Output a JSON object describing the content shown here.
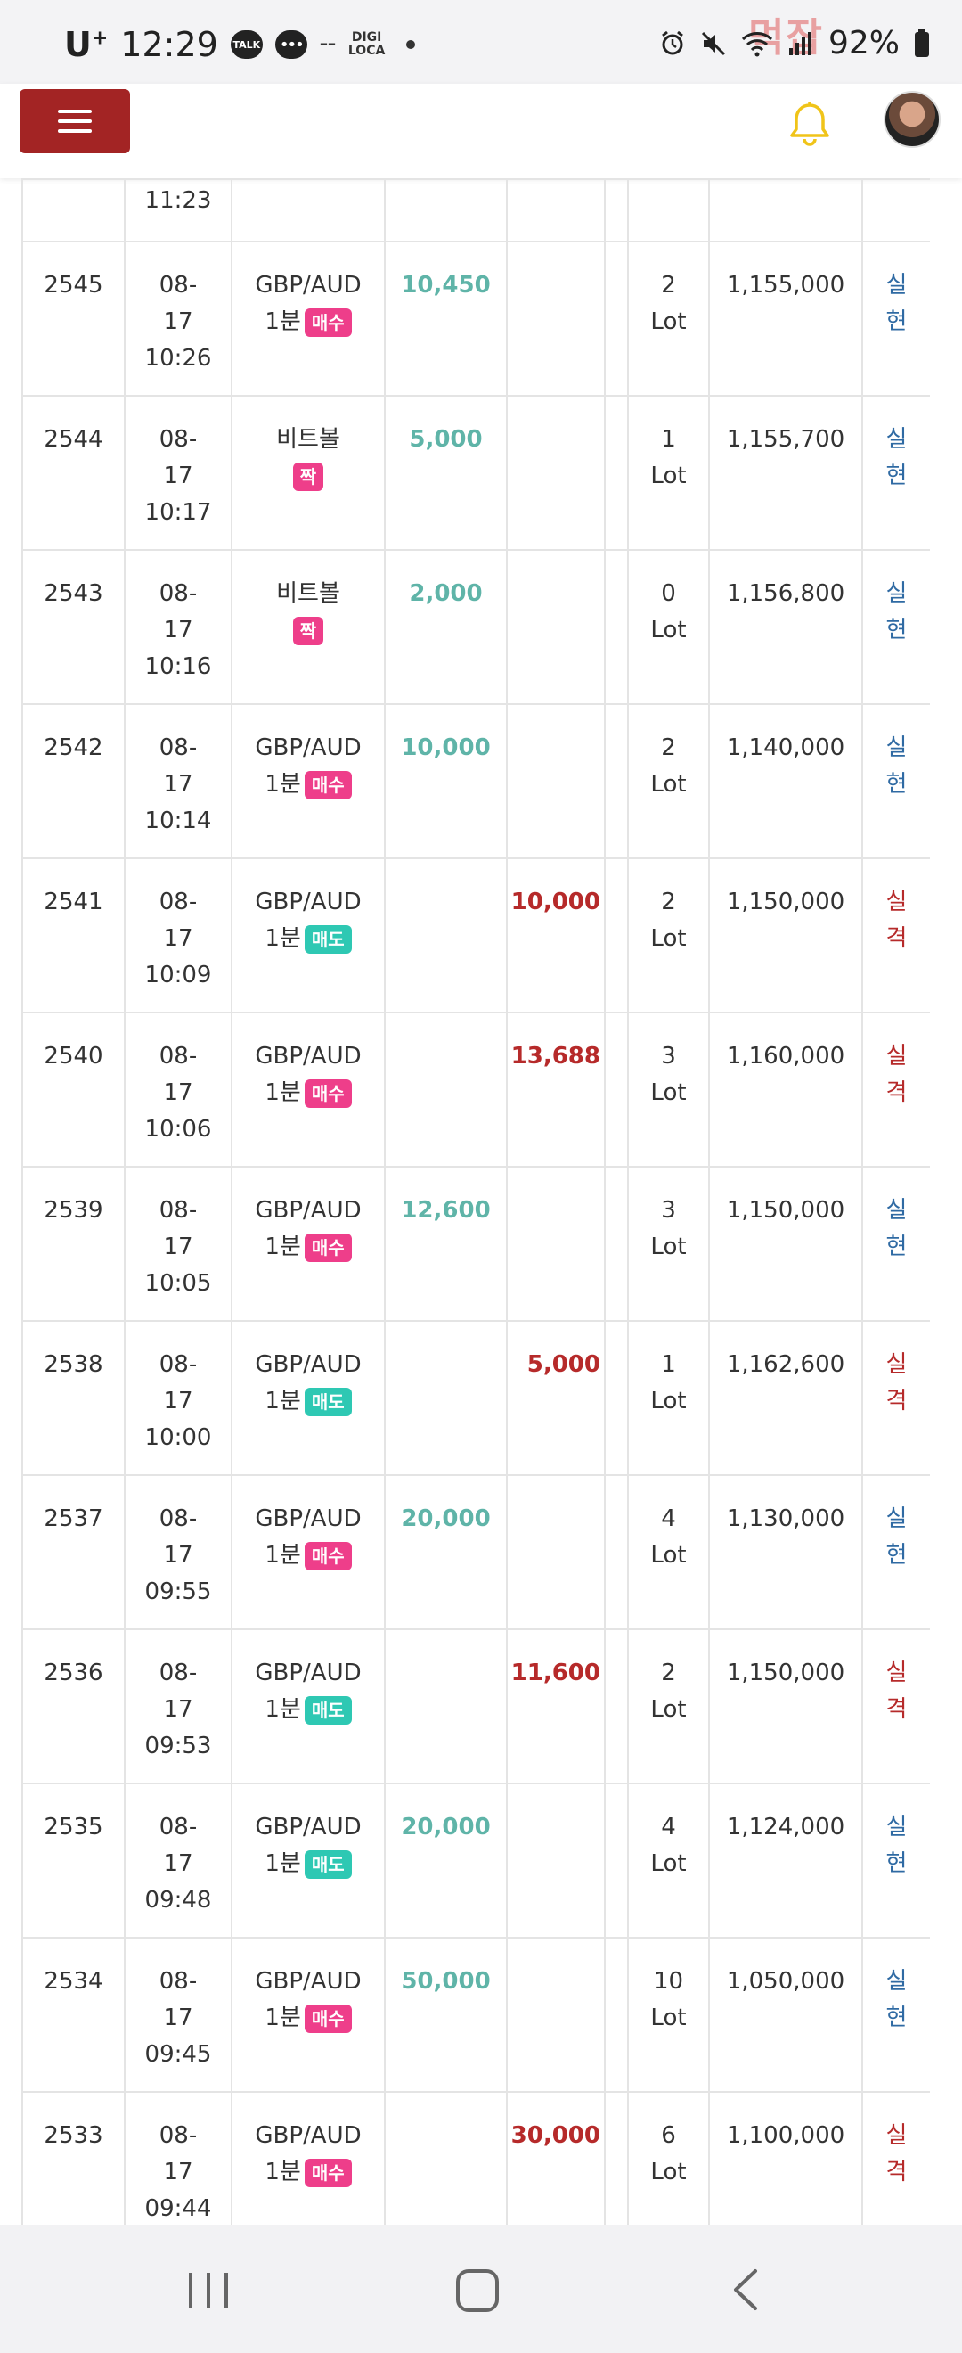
{
  "status": {
    "carrier": "U",
    "carrier_sup": "+",
    "time": "12:29",
    "talk": "TALK",
    "digi_top": "DIGI",
    "digi_bottom": "LOCA",
    "battery": "92%",
    "watermark": "먹잡"
  },
  "header": {
    "menu_icon": "hamburger-icon",
    "bell_icon": "bell-icon",
    "accent": "#a32424",
    "bell_color": "#f0c419"
  },
  "table": {
    "partial_time": "11:23",
    "rows": [
      {
        "no": "2545",
        "date": "08-",
        "day": "17",
        "time": "10:26",
        "item": "GBP/AUD",
        "period": "1분",
        "side": "매수",
        "side_type": "buy",
        "profit": "10,450",
        "loss": "",
        "lot": "2",
        "lot_unit": "Lot",
        "balance": "1,155,000",
        "res1": "실",
        "res2": "현",
        "res_type": "ok"
      },
      {
        "no": "2544",
        "date": "08-",
        "day": "17",
        "time": "10:17",
        "item": "비트볼",
        "period": "",
        "side": "짝",
        "side_type": "buy",
        "profit": "5,000",
        "loss": "",
        "lot": "1",
        "lot_unit": "Lot",
        "balance": "1,155,700",
        "res1": "실",
        "res2": "현",
        "res_type": "ok"
      },
      {
        "no": "2543",
        "date": "08-",
        "day": "17",
        "time": "10:16",
        "item": "비트볼",
        "period": "",
        "side": "짝",
        "side_type": "buy",
        "profit": "2,000",
        "loss": "",
        "lot": "0",
        "lot_unit": "Lot",
        "balance": "1,156,800",
        "res1": "실",
        "res2": "현",
        "res_type": "ok"
      },
      {
        "no": "2542",
        "date": "08-",
        "day": "17",
        "time": "10:14",
        "item": "GBP/AUD",
        "period": "1분",
        "side": "매수",
        "side_type": "buy",
        "profit": "10,000",
        "loss": "",
        "lot": "2",
        "lot_unit": "Lot",
        "balance": "1,140,000",
        "res1": "실",
        "res2": "현",
        "res_type": "ok"
      },
      {
        "no": "2541",
        "date": "08-",
        "day": "17",
        "time": "10:09",
        "item": "GBP/AUD",
        "period": "1분",
        "side": "매도",
        "side_type": "sell",
        "profit": "",
        "loss": "10,000",
        "lot": "2",
        "lot_unit": "Lot",
        "balance": "1,150,000",
        "res1": "실",
        "res2": "격",
        "res_type": "bad"
      },
      {
        "no": "2540",
        "date": "08-",
        "day": "17",
        "time": "10:06",
        "item": "GBP/AUD",
        "period": "1분",
        "side": "매수",
        "side_type": "buy",
        "profit": "",
        "loss": "13,688",
        "lot": "3",
        "lot_unit": "Lot",
        "balance": "1,160,000",
        "res1": "실",
        "res2": "격",
        "res_type": "bad"
      },
      {
        "no": "2539",
        "date": "08-",
        "day": "17",
        "time": "10:05",
        "item": "GBP/AUD",
        "period": "1분",
        "side": "매수",
        "side_type": "buy",
        "profit": "12,600",
        "loss": "",
        "lot": "3",
        "lot_unit": "Lot",
        "balance": "1,150,000",
        "res1": "실",
        "res2": "현",
        "res_type": "ok"
      },
      {
        "no": "2538",
        "date": "08-",
        "day": "17",
        "time": "10:00",
        "item": "GBP/AUD",
        "period": "1분",
        "side": "매도",
        "side_type": "sell",
        "profit": "",
        "loss": "5,000",
        "lot": "1",
        "lot_unit": "Lot",
        "balance": "1,162,600",
        "res1": "실",
        "res2": "격",
        "res_type": "bad"
      },
      {
        "no": "2537",
        "date": "08-",
        "day": "17",
        "time": "09:55",
        "item": "GBP/AUD",
        "period": "1분",
        "side": "매수",
        "side_type": "buy",
        "profit": "20,000",
        "loss": "",
        "lot": "4",
        "lot_unit": "Lot",
        "balance": "1,130,000",
        "res1": "실",
        "res2": "현",
        "res_type": "ok"
      },
      {
        "no": "2536",
        "date": "08-",
        "day": "17",
        "time": "09:53",
        "item": "GBP/AUD",
        "period": "1분",
        "side": "매도",
        "side_type": "sell",
        "profit": "",
        "loss": "11,600",
        "lot": "2",
        "lot_unit": "Lot",
        "balance": "1,150,000",
        "res1": "실",
        "res2": "격",
        "res_type": "bad"
      },
      {
        "no": "2535",
        "date": "08-",
        "day": "17",
        "time": "09:48",
        "item": "GBP/AUD",
        "period": "1분",
        "side": "매도",
        "side_type": "sell",
        "profit": "20,000",
        "loss": "",
        "lot": "4",
        "lot_unit": "Lot",
        "balance": "1,124,000",
        "res1": "실",
        "res2": "현",
        "res_type": "ok"
      },
      {
        "no": "2534",
        "date": "08-",
        "day": "17",
        "time": "09:45",
        "item": "GBP/AUD",
        "period": "1분",
        "side": "매수",
        "side_type": "buy",
        "profit": "50,000",
        "loss": "",
        "lot": "10",
        "lot_unit": "Lot",
        "balance": "1,050,000",
        "res1": "실",
        "res2": "현",
        "res_type": "ok"
      },
      {
        "no": "2533",
        "date": "08-",
        "day": "17",
        "time": "09:44",
        "item": "GBP/AUD",
        "period": "1분",
        "side": "매수",
        "side_type": "buy",
        "profit": "",
        "loss": "30,000",
        "lot": "6",
        "lot_unit": "Lot",
        "balance": "1,100,000",
        "res1": "실",
        "res2": "격",
        "res_type": "bad"
      }
    ]
  },
  "colors": {
    "profit": "#5fb4a8",
    "loss": "#b62a2a",
    "result_ok": "#2f6aa3",
    "buy_badge": "#ee3e8a",
    "sell_badge": "#2ec8b3"
  }
}
